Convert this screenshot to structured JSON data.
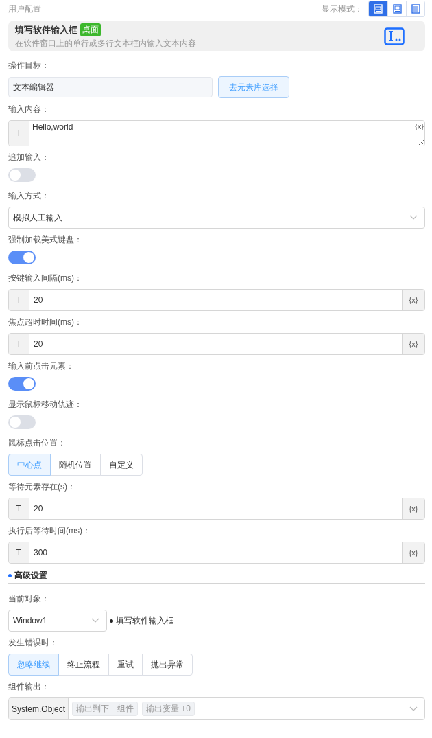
{
  "header": {
    "title": "用户配置",
    "display_mode_label": "显示模式：",
    "display_modes": [
      {
        "selected": true
      },
      {
        "selected": false
      },
      {
        "selected": false
      }
    ]
  },
  "component_card": {
    "title": "填写软件输入框",
    "badge": "桌面",
    "description": "在软件窗口上的单行或多行文本框内输入文本内容"
  },
  "fields": [
    {
      "kind": "picker",
      "label": "操作目标：",
      "value": "文本编辑器",
      "button": "去元素库选择"
    },
    {
      "kind": "textarea",
      "label": "输入内容：",
      "prefix": "T",
      "value": "Hello,world",
      "suffix": "{x}"
    },
    {
      "kind": "toggle",
      "label": "追加输入：",
      "on": false
    },
    {
      "kind": "select",
      "label": "输入方式：",
      "value": "模拟人工输入"
    },
    {
      "kind": "toggle",
      "label": "强制加载美式键盘：",
      "on": true
    },
    {
      "kind": "number",
      "label": "按键输入间隔(ms)：",
      "prefix": "T",
      "value": "20",
      "suffix": "{x}"
    },
    {
      "kind": "number",
      "label": "焦点超时时间(ms)：",
      "prefix": "T",
      "value": "20",
      "suffix": "{x}"
    },
    {
      "kind": "toggle",
      "label": "输入前点击元素：",
      "on": true
    },
    {
      "kind": "toggle",
      "label": "显示鼠标移动轨迹：",
      "on": false
    },
    {
      "kind": "segmented",
      "label": "鼠标点击位置：",
      "options": [
        {
          "label": "中心点",
          "selected": true
        },
        {
          "label": "随机位置",
          "selected": false
        },
        {
          "label": "自定义",
          "selected": false
        }
      ]
    },
    {
      "kind": "number",
      "label": "等待元素存在(s)：",
      "prefix": "T",
      "value": "20",
      "suffix": "{x}"
    },
    {
      "kind": "number",
      "label": "执行后等待时间(ms)：",
      "prefix": "T",
      "value": "300",
      "suffix": "{x}"
    },
    {
      "kind": "section",
      "label": "高级设置"
    },
    {
      "kind": "object",
      "label": "当前对象：",
      "value": "Window1",
      "note": "填写软件输入框"
    },
    {
      "kind": "segmented",
      "label": "发生错误时：",
      "options": [
        {
          "label": "忽略继续",
          "selected": true
        },
        {
          "label": "终止流程",
          "selected": false
        },
        {
          "label": "重试",
          "selected": false
        },
        {
          "label": "抛出异常",
          "selected": false
        }
      ]
    },
    {
      "kind": "output",
      "label": "组件输出：",
      "type": "System.Object",
      "tags": [
        "输出到下一组件",
        "输出变量 +0"
      ]
    }
  ]
}
